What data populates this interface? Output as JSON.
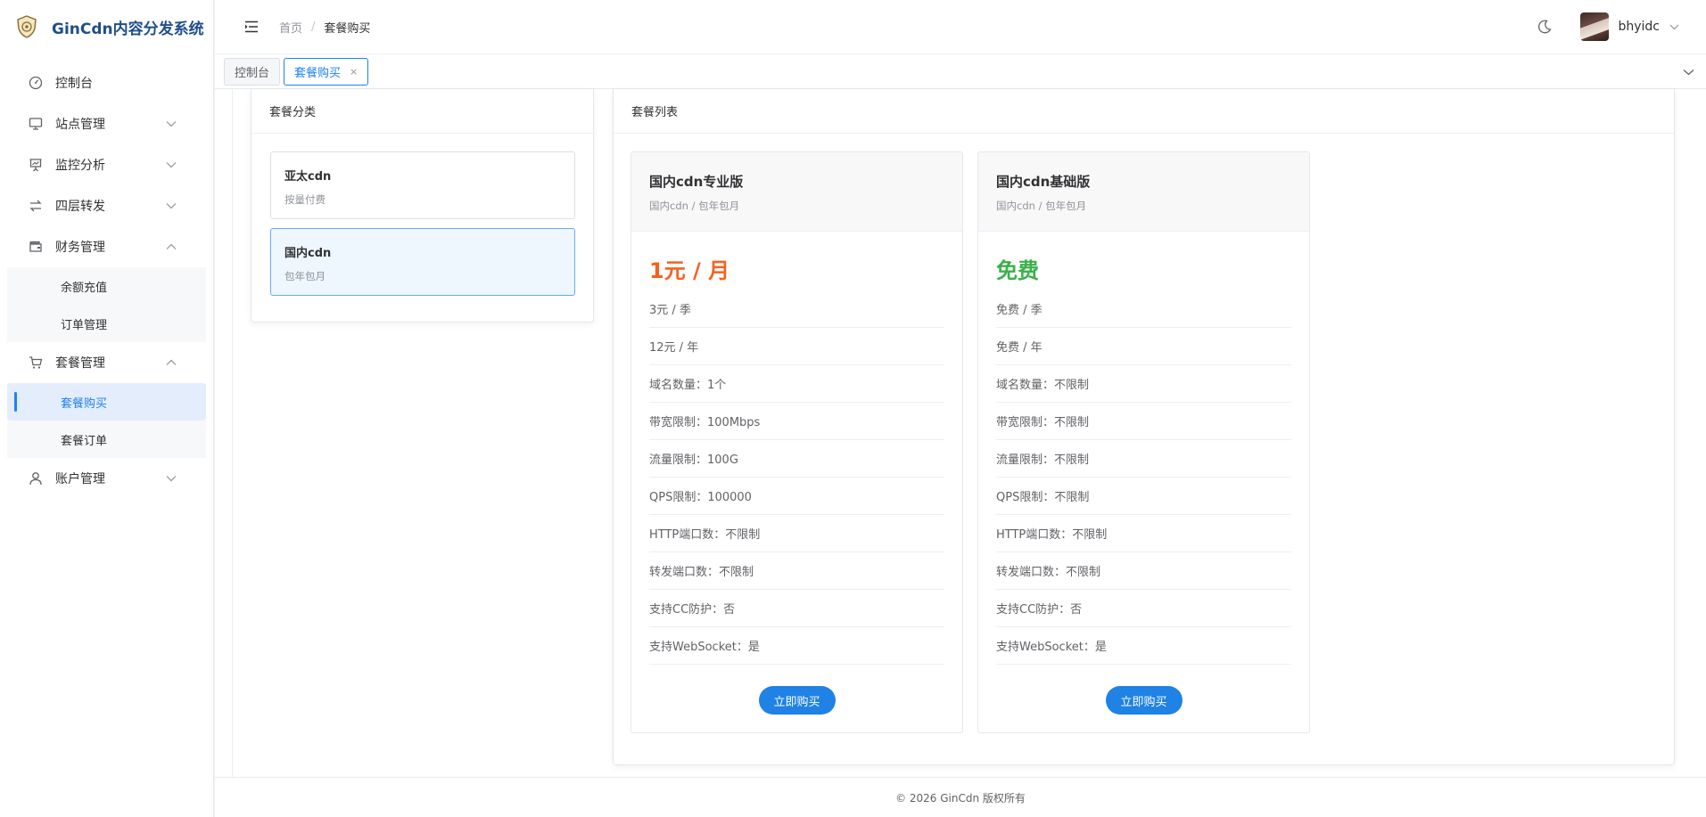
{
  "brand": {
    "title": "GinCdn内容分发系统",
    "logo_icon": "shield-logo-icon"
  },
  "sidebar": {
    "items": [
      {
        "label": "控制台",
        "icon": "dashboard-icon"
      },
      {
        "label": "站点管理",
        "icon": "monitor-icon"
      },
      {
        "label": "监控分析",
        "icon": "presentation-chart-icon"
      },
      {
        "label": "四层转发",
        "icon": "forward-arrows-icon"
      },
      {
        "label": "财务管理",
        "icon": "wallet-icon",
        "children": [
          "余额充值",
          "订单管理"
        ]
      },
      {
        "label": "套餐管理",
        "icon": "cart-icon",
        "children": [
          "套餐购买",
          "套餐订单"
        ]
      },
      {
        "label": "账户管理",
        "icon": "user-icon"
      }
    ],
    "active_subitem": "套餐购买"
  },
  "header": {
    "breadcrumb": {
      "home": "首页",
      "separator": "/",
      "current": "套餐购买"
    },
    "username": "bhyidc"
  },
  "tabs": [
    {
      "label": "控制台"
    },
    {
      "label": "套餐购买",
      "close": "×"
    }
  ],
  "category_card": {
    "title": "套餐分类",
    "items": [
      {
        "name": "亚太cdn",
        "sub": "按量付费"
      },
      {
        "name": "国内cdn",
        "sub": "包年包月"
      }
    ]
  },
  "plan_card": {
    "title": "套餐列表",
    "plans": [
      {
        "name": "国内cdn专业版",
        "sub": "国内cdn / 包年包月",
        "price": "1元 / 月",
        "features": [
          "3元 / 季",
          "12元 / 年",
          "域名数量：1个",
          "带宽限制：100Mbps",
          "流量限制：100G",
          "QPS限制：100000",
          "HTTP端口数：不限制",
          "转发端口数：不限制",
          "支持CC防护：否",
          "支持WebSocket：是"
        ],
        "button": "立即购买"
      },
      {
        "name": "国内cdn基础版",
        "sub": "国内cdn / 包年包月",
        "price": "免费",
        "features": [
          "免费 / 季",
          "免费 / 年",
          "域名数量：不限制",
          "带宽限制：不限制",
          "流量限制：不限制",
          "QPS限制：不限制",
          "HTTP端口数：不限制",
          "转发端口数：不限制",
          "支持CC防护：否",
          "支持WebSocket：是"
        ],
        "button": "立即购买"
      }
    ]
  },
  "footer": {
    "text": "© 2026 GinCdn 版权所有"
  },
  "colors": {
    "accent": "#2080f0",
    "price_orange": "#f5621f",
    "price_green": "#3bb04b",
    "button": "#1f82e4"
  }
}
